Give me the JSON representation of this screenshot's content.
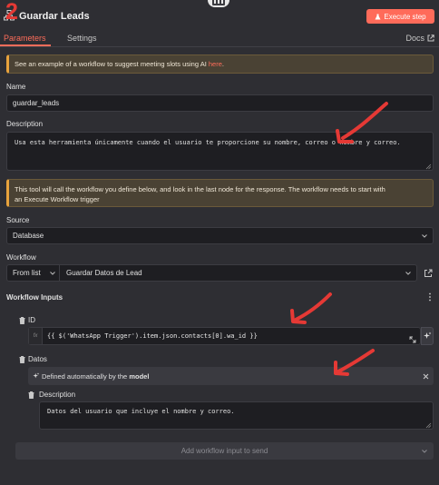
{
  "header": {
    "title": "Guardar Leads",
    "overlay_number": "2",
    "execute_label": "Execute step"
  },
  "tabs": {
    "parameters": "Parameters",
    "settings": "Settings",
    "docs": "Docs"
  },
  "notice1": {
    "text": "See an example of a workflow to suggest meeting slots using AI ",
    "link": "here",
    "suffix": "."
  },
  "name": {
    "label": "Name",
    "value": "guardar_leads"
  },
  "description": {
    "label": "Description",
    "value": "Usa esta herramienta únicamente cuando el usuario te proporcione su nombre, correo o nombre y correo."
  },
  "notice2": {
    "line1": "This tool will call the workflow you define below, and look in the last node for the response. The workflow needs to start with",
    "line2": "an Execute Workflow trigger"
  },
  "source": {
    "label": "Source",
    "value": "Database"
  },
  "workflow": {
    "label": "Workflow",
    "mode": "From list",
    "value": "Guardar Datos de Lead"
  },
  "inputs": {
    "title": "Workflow Inputs",
    "id_label": "ID",
    "id_fx": "fx",
    "id_value": "{{ $('WhatsApp Trigger').item.json.contacts[0].wa_id }}",
    "datos_label": "Datos",
    "auto_text": "Defined automatically by the ",
    "auto_bold": "model",
    "desc_label": "Description",
    "desc_value": "Datos del usuario que incluye el nombre y correo.",
    "add_label": "Add workflow input to send"
  },
  "colors": {
    "accent": "#ff6d5a",
    "annotation_red": "#e53935",
    "background": "#2e2e33",
    "notice_bg": "#4a4234"
  }
}
